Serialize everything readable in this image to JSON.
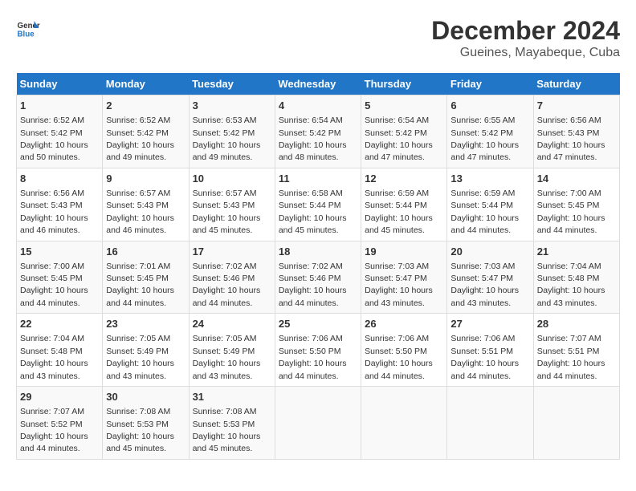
{
  "logo": {
    "line1": "General",
    "line2": "Blue"
  },
  "title": "December 2024",
  "subtitle": "Gueines, Mayabeque, Cuba",
  "days_of_week": [
    "Sunday",
    "Monday",
    "Tuesday",
    "Wednesday",
    "Thursday",
    "Friday",
    "Saturday"
  ],
  "weeks": [
    [
      {
        "day": "1",
        "sunrise": "6:52 AM",
        "sunset": "5:42 PM",
        "daylight": "10 hours and 50 minutes."
      },
      {
        "day": "2",
        "sunrise": "6:52 AM",
        "sunset": "5:42 PM",
        "daylight": "10 hours and 49 minutes."
      },
      {
        "day": "3",
        "sunrise": "6:53 AM",
        "sunset": "5:42 PM",
        "daylight": "10 hours and 49 minutes."
      },
      {
        "day": "4",
        "sunrise": "6:54 AM",
        "sunset": "5:42 PM",
        "daylight": "10 hours and 48 minutes."
      },
      {
        "day": "5",
        "sunrise": "6:54 AM",
        "sunset": "5:42 PM",
        "daylight": "10 hours and 47 minutes."
      },
      {
        "day": "6",
        "sunrise": "6:55 AM",
        "sunset": "5:42 PM",
        "daylight": "10 hours and 47 minutes."
      },
      {
        "day": "7",
        "sunrise": "6:56 AM",
        "sunset": "5:43 PM",
        "daylight": "10 hours and 47 minutes."
      }
    ],
    [
      {
        "day": "8",
        "sunrise": "6:56 AM",
        "sunset": "5:43 PM",
        "daylight": "10 hours and 46 minutes."
      },
      {
        "day": "9",
        "sunrise": "6:57 AM",
        "sunset": "5:43 PM",
        "daylight": "10 hours and 46 minutes."
      },
      {
        "day": "10",
        "sunrise": "6:57 AM",
        "sunset": "5:43 PM",
        "daylight": "10 hours and 45 minutes."
      },
      {
        "day": "11",
        "sunrise": "6:58 AM",
        "sunset": "5:44 PM",
        "daylight": "10 hours and 45 minutes."
      },
      {
        "day": "12",
        "sunrise": "6:59 AM",
        "sunset": "5:44 PM",
        "daylight": "10 hours and 45 minutes."
      },
      {
        "day": "13",
        "sunrise": "6:59 AM",
        "sunset": "5:44 PM",
        "daylight": "10 hours and 44 minutes."
      },
      {
        "day": "14",
        "sunrise": "7:00 AM",
        "sunset": "5:45 PM",
        "daylight": "10 hours and 44 minutes."
      }
    ],
    [
      {
        "day": "15",
        "sunrise": "7:00 AM",
        "sunset": "5:45 PM",
        "daylight": "10 hours and 44 minutes."
      },
      {
        "day": "16",
        "sunrise": "7:01 AM",
        "sunset": "5:45 PM",
        "daylight": "10 hours and 44 minutes."
      },
      {
        "day": "17",
        "sunrise": "7:02 AM",
        "sunset": "5:46 PM",
        "daylight": "10 hours and 44 minutes."
      },
      {
        "day": "18",
        "sunrise": "7:02 AM",
        "sunset": "5:46 PM",
        "daylight": "10 hours and 44 minutes."
      },
      {
        "day": "19",
        "sunrise": "7:03 AM",
        "sunset": "5:47 PM",
        "daylight": "10 hours and 43 minutes."
      },
      {
        "day": "20",
        "sunrise": "7:03 AM",
        "sunset": "5:47 PM",
        "daylight": "10 hours and 43 minutes."
      },
      {
        "day": "21",
        "sunrise": "7:04 AM",
        "sunset": "5:48 PM",
        "daylight": "10 hours and 43 minutes."
      }
    ],
    [
      {
        "day": "22",
        "sunrise": "7:04 AM",
        "sunset": "5:48 PM",
        "daylight": "10 hours and 43 minutes."
      },
      {
        "day": "23",
        "sunrise": "7:05 AM",
        "sunset": "5:49 PM",
        "daylight": "10 hours and 43 minutes."
      },
      {
        "day": "24",
        "sunrise": "7:05 AM",
        "sunset": "5:49 PM",
        "daylight": "10 hours and 43 minutes."
      },
      {
        "day": "25",
        "sunrise": "7:06 AM",
        "sunset": "5:50 PM",
        "daylight": "10 hours and 44 minutes."
      },
      {
        "day": "26",
        "sunrise": "7:06 AM",
        "sunset": "5:50 PM",
        "daylight": "10 hours and 44 minutes."
      },
      {
        "day": "27",
        "sunrise": "7:06 AM",
        "sunset": "5:51 PM",
        "daylight": "10 hours and 44 minutes."
      },
      {
        "day": "28",
        "sunrise": "7:07 AM",
        "sunset": "5:51 PM",
        "daylight": "10 hours and 44 minutes."
      }
    ],
    [
      {
        "day": "29",
        "sunrise": "7:07 AM",
        "sunset": "5:52 PM",
        "daylight": "10 hours and 44 minutes."
      },
      {
        "day": "30",
        "sunrise": "7:08 AM",
        "sunset": "5:53 PM",
        "daylight": "10 hours and 45 minutes."
      },
      {
        "day": "31",
        "sunrise": "7:08 AM",
        "sunset": "5:53 PM",
        "daylight": "10 hours and 45 minutes."
      },
      null,
      null,
      null,
      null
    ]
  ],
  "labels": {
    "sunrise": "Sunrise:",
    "sunset": "Sunset:",
    "daylight": "Daylight:"
  }
}
